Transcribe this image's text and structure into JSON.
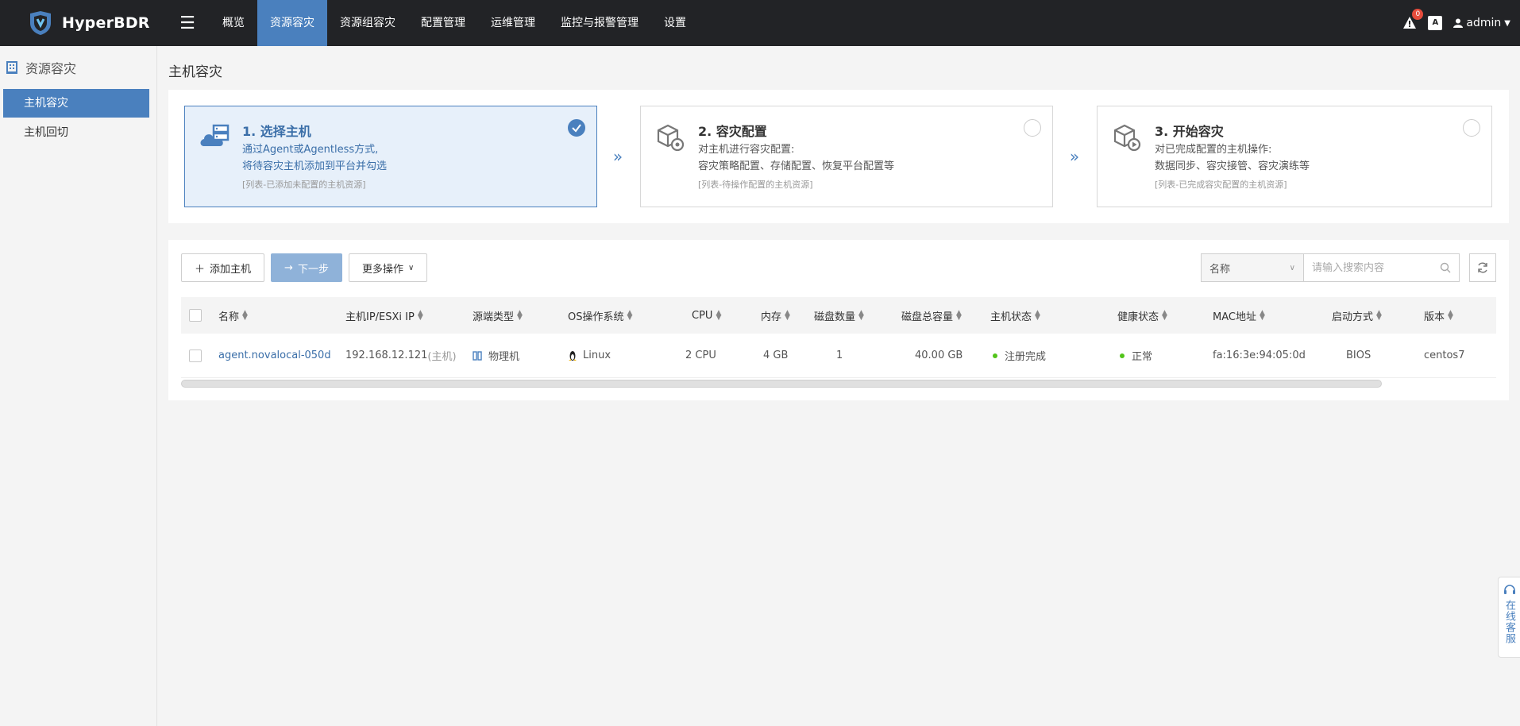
{
  "app": {
    "name": "HyperBDR"
  },
  "nav": [
    {
      "label": "概览",
      "active": false
    },
    {
      "label": "资源容灾",
      "active": true
    },
    {
      "label": "资源组容灾",
      "active": false
    },
    {
      "label": "配置管理",
      "active": false
    },
    {
      "label": "运维管理",
      "active": false
    },
    {
      "label": "监控与报警管理",
      "active": false
    },
    {
      "label": "设置",
      "active": false
    }
  ],
  "header": {
    "alert_count": "0",
    "lang_icon": "A",
    "user": "admin"
  },
  "sidebar": {
    "title": "资源容灾",
    "items": [
      {
        "label": "主机容灾",
        "active": true
      },
      {
        "label": "主机回切",
        "active": false
      }
    ]
  },
  "page": {
    "title": "主机容灾"
  },
  "steps": [
    {
      "title": "1. 选择主机",
      "desc1": "通过Agent或Agentless方式,",
      "desc2": "将待容灾主机添加到平台并勾选",
      "note": "[列表-已添加未配置的主机资源]",
      "active": true
    },
    {
      "title": "2. 容灾配置",
      "desc1": "对主机进行容灾配置:",
      "desc2": "容灾策略配置、存储配置、恢复平台配置等",
      "note": "[列表-待操作配置的主机资源]",
      "active": false
    },
    {
      "title": "3. 开始容灾",
      "desc1": "对已完成配置的主机操作:",
      "desc2": "数据同步、容灾接管、容灾演练等",
      "note": "[列表-已完成容灾配置的主机资源]",
      "active": false
    }
  ],
  "toolbar": {
    "add_host": "添加主机",
    "next_step": "下一步",
    "more_ops": "更多操作"
  },
  "search": {
    "field": "名称",
    "placeholder": "请输入搜索内容"
  },
  "table": {
    "columns": [
      "名称",
      "主机IP/ESXi IP",
      "源端类型",
      "OS操作系统",
      "CPU",
      "内存",
      "磁盘数量",
      "磁盘总容量",
      "主机状态",
      "健康状态",
      "MAC地址",
      "启动方式",
      "版本"
    ],
    "rows": [
      {
        "name": "agent.novalocal-050d",
        "ip": "192.168.12.121",
        "ip_suffix": "(主机)",
        "source_type": "物理机",
        "os": "Linux",
        "cpu": "2 CPU",
        "memory": "4 GB",
        "disk_count": "1",
        "disk_total": "40.00 GB",
        "host_status": "注册完成",
        "health_status": "正常",
        "mac": "fa:16:3e:94:05:0d",
        "boot_mode": "BIOS",
        "version": "centos7"
      }
    ]
  },
  "service": {
    "label": "在线客服"
  },
  "colors": {
    "accent": "#4a80be",
    "topbar": "#222326",
    "status_ok": "#52c41a"
  }
}
